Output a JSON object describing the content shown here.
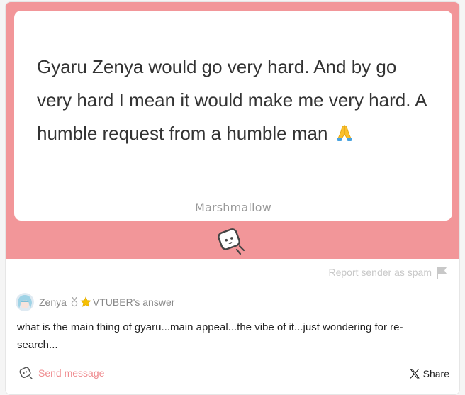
{
  "message": {
    "text": "Gyaru Zenya would go very hard. And by go very hard I mean it would make me very hard. A humble request from a humble man",
    "emoji_icon": "folded-hands-icon",
    "brand": "Marshmallow",
    "mascot_icon": "marshmallow-icon"
  },
  "actions": {
    "report_spam": "Report sender as spam",
    "report_icon": "flag-icon",
    "send_message": "Send message",
    "send_icon": "marshmallow-outline-icon",
    "share": "Share",
    "share_icon": "x-logo-icon"
  },
  "answer": {
    "name": "Zenya",
    "label": "VTUBER's answer",
    "text": "what is the main thing of gyaru...main appeal...the vibe of it...just wondering for re-search...",
    "badge_icons": [
      "medal-icon",
      "star-icon"
    ]
  },
  "colors": {
    "band": "#f29699",
    "accent": "#ef8b8f",
    "muted": "#c8c8c8"
  }
}
